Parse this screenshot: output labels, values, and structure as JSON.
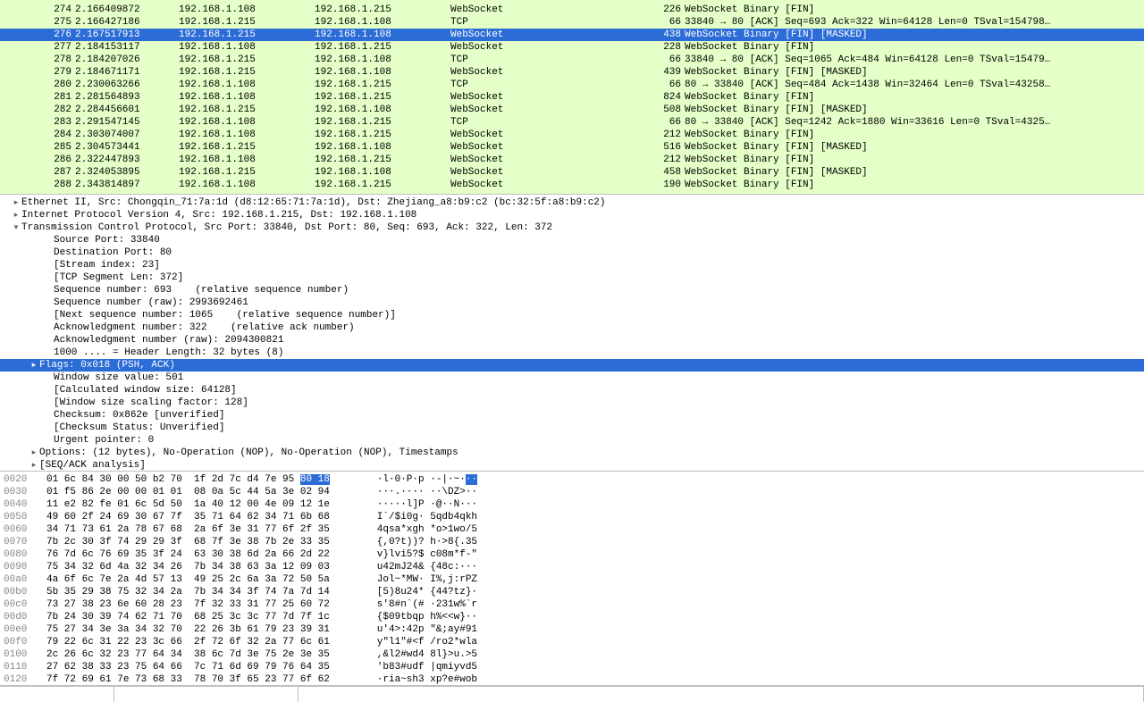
{
  "packet_list": {
    "selected": 276,
    "rows": [
      {
        "no": "",
        "time": "",
        "src": "",
        "dst": "",
        "proto": "",
        "len": "",
        "info": "",
        "green": true,
        "cut": true
      },
      {
        "no": 274,
        "time": "2.166409872",
        "src": "192.168.1.108",
        "dst": "192.168.1.215",
        "proto": "WebSocket",
        "len": 226,
        "info": "WebSocket Binary [FIN]",
        "green": true
      },
      {
        "no": 275,
        "time": "2.166427186",
        "src": "192.168.1.215",
        "dst": "192.168.1.108",
        "proto": "TCP",
        "len": 66,
        "info": "33840 → 80 [ACK] Seq=693 Ack=322 Win=64128 Len=0 TSval=154798…",
        "green": true
      },
      {
        "no": 276,
        "time": "2.167517913",
        "src": "192.168.1.215",
        "dst": "192.168.1.108",
        "proto": "WebSocket",
        "len": 438,
        "info": "WebSocket Binary [FIN] [MASKED]",
        "green": true,
        "selected": true
      },
      {
        "no": 277,
        "time": "2.184153117",
        "src": "192.168.1.108",
        "dst": "192.168.1.215",
        "proto": "WebSocket",
        "len": 228,
        "info": "WebSocket Binary [FIN]",
        "green": true
      },
      {
        "no": 278,
        "time": "2.184207026",
        "src": "192.168.1.215",
        "dst": "192.168.1.108",
        "proto": "TCP",
        "len": 66,
        "info": "33840 → 80 [ACK] Seq=1065 Ack=484 Win=64128 Len=0 TSval=15479…",
        "green": true
      },
      {
        "no": 279,
        "time": "2.184671171",
        "src": "192.168.1.215",
        "dst": "192.168.1.108",
        "proto": "WebSocket",
        "len": 439,
        "info": "WebSocket Binary [FIN] [MASKED]",
        "green": true
      },
      {
        "no": 280,
        "time": "2.230063266",
        "src": "192.168.1.108",
        "dst": "192.168.1.215",
        "proto": "TCP",
        "len": 66,
        "info": "80 → 33840 [ACK] Seq=484 Ack=1438 Win=32464 Len=0 TSval=43258…",
        "green": true
      },
      {
        "no": 281,
        "time": "2.281564893",
        "src": "192.168.1.108",
        "dst": "192.168.1.215",
        "proto": "WebSocket",
        "len": 824,
        "info": "WebSocket Binary [FIN]",
        "green": true
      },
      {
        "no": 282,
        "time": "2.284456601",
        "src": "192.168.1.215",
        "dst": "192.168.1.108",
        "proto": "WebSocket",
        "len": 508,
        "info": "WebSocket Binary [FIN] [MASKED]",
        "green": true
      },
      {
        "no": 283,
        "time": "2.291547145",
        "src": "192.168.1.108",
        "dst": "192.168.1.215",
        "proto": "TCP",
        "len": 66,
        "info": "80 → 33840 [ACK] Seq=1242 Ack=1880 Win=33616 Len=0 TSval=4325…",
        "green": true
      },
      {
        "no": 284,
        "time": "2.303074007",
        "src": "192.168.1.108",
        "dst": "192.168.1.215",
        "proto": "WebSocket",
        "len": 212,
        "info": "WebSocket Binary [FIN]",
        "green": true
      },
      {
        "no": 285,
        "time": "2.304573441",
        "src": "192.168.1.215",
        "dst": "192.168.1.108",
        "proto": "WebSocket",
        "len": 516,
        "info": "WebSocket Binary [FIN] [MASKED]",
        "green": true
      },
      {
        "no": 286,
        "time": "2.322447893",
        "src": "192.168.1.108",
        "dst": "192.168.1.215",
        "proto": "WebSocket",
        "len": 212,
        "info": "WebSocket Binary [FIN]",
        "green": true
      },
      {
        "no": 287,
        "time": "2.324053895",
        "src": "192.168.1.215",
        "dst": "192.168.1.108",
        "proto": "WebSocket",
        "len": 458,
        "info": "WebSocket Binary [FIN] [MASKED]",
        "green": true
      },
      {
        "no": 288,
        "time": "2.343814897",
        "src": "192.168.1.108",
        "dst": "192.168.1.215",
        "proto": "WebSocket",
        "len": 190,
        "info": "WebSocket Binary [FIN]",
        "green": true
      },
      {
        "no": "",
        "time": "",
        "src": "",
        "dst": "",
        "proto": "",
        "len": "",
        "info": "",
        "green": true,
        "cut": true
      }
    ]
  },
  "details": {
    "selected_index": 13,
    "rows": [
      {
        "arrow": "▸",
        "indent": 0,
        "text": "Ethernet II, Src: Chongqin_71:7a:1d (d8:12:65:71:7a:1d), Dst: Zhejiang_a8:b9:c2 (bc:32:5f:a8:b9:c2)"
      },
      {
        "arrow": "▸",
        "indent": 0,
        "text": "Internet Protocol Version 4, Src: 192.168.1.215, Dst: 192.168.1.108"
      },
      {
        "arrow": "▾",
        "indent": 0,
        "text": "Transmission Control Protocol, Src Port: 33840, Dst Port: 80, Seq: 693, Ack: 322, Len: 372"
      },
      {
        "arrow": "",
        "indent": 2,
        "text": "Source Port: 33840"
      },
      {
        "arrow": "",
        "indent": 2,
        "text": "Destination Port: 80"
      },
      {
        "arrow": "",
        "indent": 2,
        "text": "[Stream index: 23]"
      },
      {
        "arrow": "",
        "indent": 2,
        "text": "[TCP Segment Len: 372]"
      },
      {
        "arrow": "",
        "indent": 2,
        "text": "Sequence number: 693    (relative sequence number)"
      },
      {
        "arrow": "",
        "indent": 2,
        "text": "Sequence number (raw): 2993692461"
      },
      {
        "arrow": "",
        "indent": 2,
        "text": "[Next sequence number: 1065    (relative sequence number)]"
      },
      {
        "arrow": "",
        "indent": 2,
        "text": "Acknowledgment number: 322    (relative ack number)"
      },
      {
        "arrow": "",
        "indent": 2,
        "text": "Acknowledgment number (raw): 2094300821"
      },
      {
        "arrow": "",
        "indent": 2,
        "text": "1000 .... = Header Length: 32 bytes (8)"
      },
      {
        "arrow": "▸",
        "indent": 1,
        "text": "Flags: 0x018 (PSH, ACK)",
        "selected": true
      },
      {
        "arrow": "",
        "indent": 2,
        "text": "Window size value: 501"
      },
      {
        "arrow": "",
        "indent": 2,
        "text": "[Calculated window size: 64128]"
      },
      {
        "arrow": "",
        "indent": 2,
        "text": "[Window size scaling factor: 128]"
      },
      {
        "arrow": "",
        "indent": 2,
        "text": "Checksum: 0x862e [unverified]"
      },
      {
        "arrow": "",
        "indent": 2,
        "text": "[Checksum Status: Unverified]"
      },
      {
        "arrow": "",
        "indent": 2,
        "text": "Urgent pointer: 0"
      },
      {
        "arrow": "▸",
        "indent": 1,
        "text": "Options: (12 bytes), No-Operation (NOP), No-Operation (NOP), Timestamps"
      },
      {
        "arrow": "▸",
        "indent": 1,
        "text": "[SEQ/ACK analysis]"
      }
    ]
  },
  "hex": {
    "highlight_row": 0,
    "highlight_bytes": "80 18",
    "rows": [
      {
        "off": "0020",
        "b1": "01 6c 84 30 00 50 b2 70  1f 2d 7c d4 7e 95 ",
        "hl": "80 18",
        "b2": "",
        "ascii_pre": "·l·0·P·p ·-|·~·",
        "ascii_hl": "··"
      },
      {
        "off": "0030",
        "bytes": "01 f5 86 2e 00 00 01 01  08 0a 5c 44 5a 3e 02 94",
        "ascii": "···.···· ··\\DZ>··"
      },
      {
        "off": "0040",
        "bytes": "11 e2 82 fe 01 6c 5d 50  1a 40 12 00 4e 09 12 1e",
        "ascii": "·····l]P ·@··N···"
      },
      {
        "off": "0050",
        "bytes": "49 60 2f 24 69 30 67 7f  35 71 64 62 34 71 6b 68",
        "ascii": "I`/$i0g· 5qdb4qkh"
      },
      {
        "off": "0060",
        "bytes": "34 71 73 61 2a 78 67 68  2a 6f 3e 31 77 6f 2f 35",
        "ascii": "4qsa*xgh *o>1wo/5"
      },
      {
        "off": "0070",
        "bytes": "7b 2c 30 3f 74 29 29 3f  68 7f 3e 38 7b 2e 33 35",
        "ascii": "{,0?t))? h·>8{.35"
      },
      {
        "off": "0080",
        "bytes": "76 7d 6c 76 69 35 3f 24  63 30 38 6d 2a 66 2d 22",
        "ascii": "v}lvi5?$ c08m*f-\""
      },
      {
        "off": "0090",
        "bytes": "75 34 32 6d 4a 32 34 26  7b 34 38 63 3a 12 09 03",
        "ascii": "u42mJ24& {48c:···"
      },
      {
        "off": "00a0",
        "bytes": "4a 6f 6c 7e 2a 4d 57 13  49 25 2c 6a 3a 72 50 5a",
        "ascii": "Jol~*MW· I%,j:rPZ"
      },
      {
        "off": "00b0",
        "bytes": "5b 35 29 38 75 32 34 2a  7b 34 34 3f 74 7a 7d 14",
        "ascii": "[5)8u24* {44?tz}·"
      },
      {
        "off": "00c0",
        "bytes": "73 27 38 23 6e 60 28 23  7f 32 33 31 77 25 60 72",
        "ascii": "s'8#n`(# ·231w%`r"
      },
      {
        "off": "00d0",
        "bytes": "7b 24 30 39 74 62 71 70  68 25 3c 3c 77 7d 7f 1c",
        "ascii": "{$09tbqp h%<<w}··"
      },
      {
        "off": "00e0",
        "bytes": "75 27 34 3e 3a 34 32 70  22 26 3b 61 79 23 39 31",
        "ascii": "u'4>:42p \"&;ay#91"
      },
      {
        "off": "00f0",
        "bytes": "79 22 6c 31 22 23 3c 66  2f 72 6f 32 2a 77 6c 61",
        "ascii": "y\"l1\"#<f /ro2*wla"
      },
      {
        "off": "0100",
        "bytes": "2c 26 6c 32 23 77 64 34  38 6c 7d 3e 75 2e 3e 35",
        "ascii": ",&l2#wd4 8l}>u.>5"
      },
      {
        "off": "0110",
        "bytes": "27 62 38 33 23 75 64 66  7c 71 6d 69 79 76 64 35",
        "ascii": "'b83#udf |qmiyvd5"
      },
      {
        "off": "0120",
        "bytes": "7f 72 69 61 7e 73 68 33  78 70 3f 65 23 77 6f 62",
        "ascii": "·ria~sh3 xp?e#wob"
      }
    ]
  }
}
